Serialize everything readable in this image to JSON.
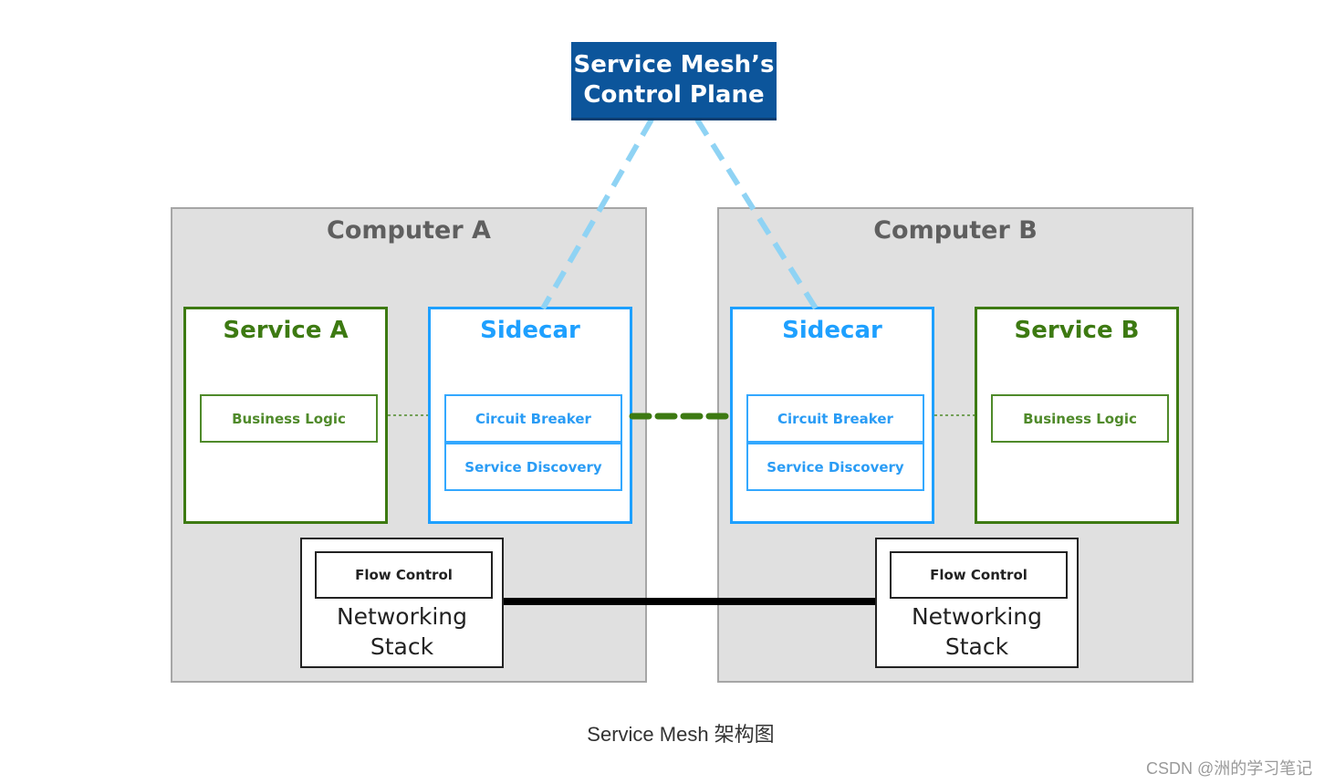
{
  "control_plane": {
    "line1": "Service Mesh’s",
    "line2": "Control Plane"
  },
  "computers": [
    {
      "title": "Computer A",
      "service": {
        "title": "Service A",
        "component": "Business Logic"
      },
      "sidecar": {
        "title": "Sidecar",
        "components": [
          "Circuit Breaker",
          "Service Discovery"
        ]
      },
      "network": {
        "component": "Flow Control",
        "line1": "Networking",
        "line2": "Stack"
      }
    },
    {
      "title": "Computer B",
      "service": {
        "title": "Service B",
        "component": "Business Logic"
      },
      "sidecar": {
        "title": "Sidecar",
        "components": [
          "Circuit Breaker",
          "Service Discovery"
        ]
      },
      "network": {
        "component": "Flow Control",
        "line1": "Networking",
        "line2": "Stack"
      }
    }
  ],
  "colors": {
    "control_plane": "#0c559b",
    "service": "#3d7a12",
    "sidecar": "#1ea0ff",
    "control_link": "#8fd3f4",
    "sidecar_link": "#3d7a12",
    "network_link": "#000000"
  },
  "caption": "Service Mesh 架构图",
  "watermark": "CSDN @洲的学习笔记"
}
